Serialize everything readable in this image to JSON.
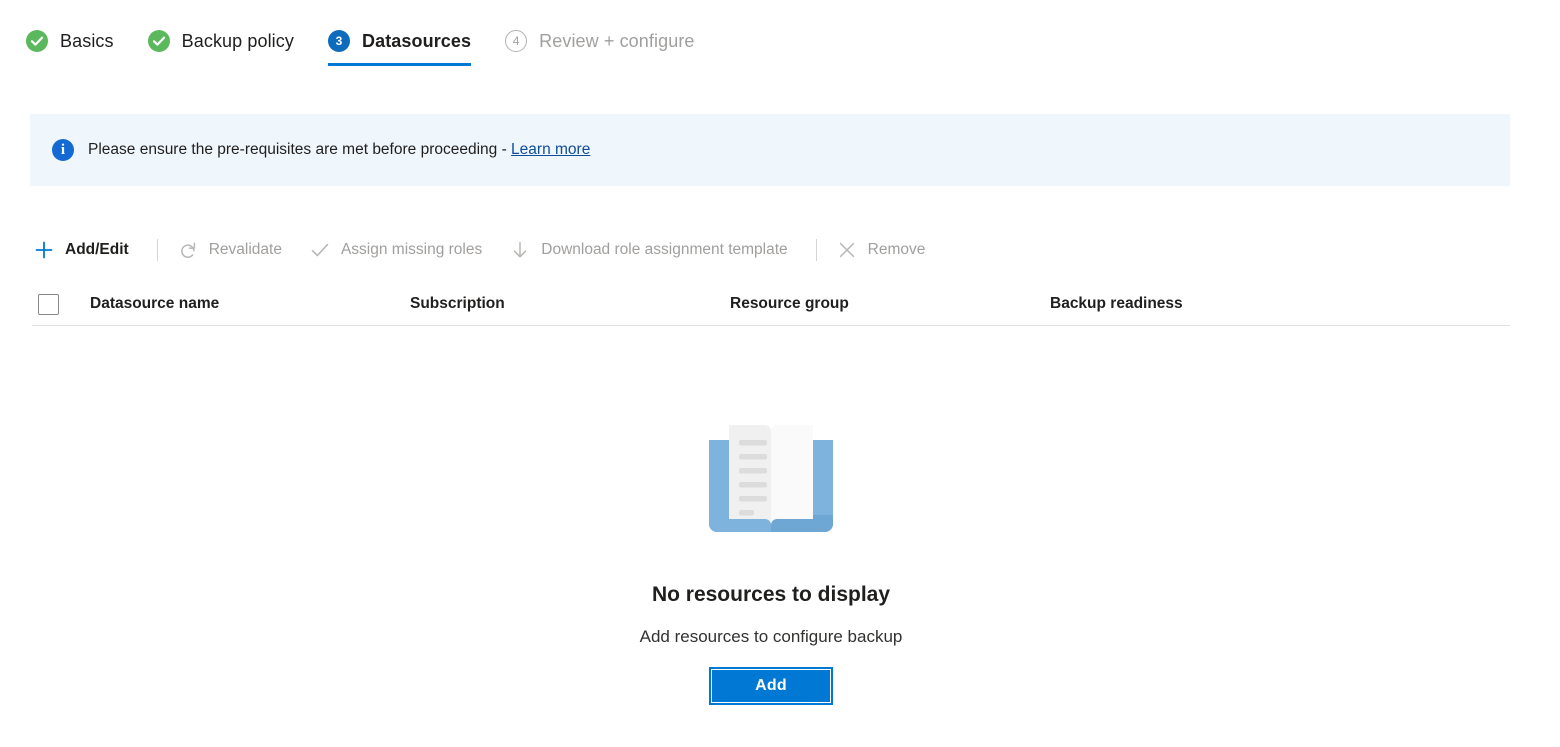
{
  "wizard": {
    "steps": [
      {
        "label": "Basics",
        "state": "done",
        "badge": "check-icon"
      },
      {
        "label": "Backup policy",
        "state": "done",
        "badge": "check-icon"
      },
      {
        "label": "Datasources",
        "state": "current",
        "badge": "3"
      },
      {
        "label": "Review + configure",
        "state": "upcoming",
        "badge": "4"
      }
    ]
  },
  "banner": {
    "icon": "info-icon",
    "text": "Please ensure the pre-requisites are met before proceeding - ",
    "link_text": "Learn more"
  },
  "toolbar": {
    "commands": [
      {
        "label": "Add/Edit",
        "icon": "plus-icon",
        "enabled": true
      },
      {
        "label": "Revalidate",
        "icon": "refresh-icon",
        "enabled": false
      },
      {
        "label": "Assign missing roles",
        "icon": "checkmark-icon",
        "enabled": false
      },
      {
        "label": "Download role assignment template",
        "icon": "download-arrow-icon",
        "enabled": false
      },
      {
        "label": "Remove",
        "icon": "close-x-icon",
        "enabled": false
      }
    ]
  },
  "table": {
    "select_all_checked": false,
    "columns": [
      "Datasource name",
      "Subscription",
      "Resource group",
      "Backup readiness"
    ],
    "rows": []
  },
  "empty_state": {
    "illustration": "open-book-icon",
    "title": "No resources to display",
    "subtitle": "Add resources to configure backup",
    "button_label": "Add"
  },
  "colors": {
    "accent": "#0078d4",
    "step_done": "#5cb85c",
    "step_current": "#0f6cbd",
    "banner_bg": "#eff6fc",
    "link": "#0f4c9c",
    "book_cover": "#7eb3dd",
    "disabled_text": "#a19f9d"
  }
}
